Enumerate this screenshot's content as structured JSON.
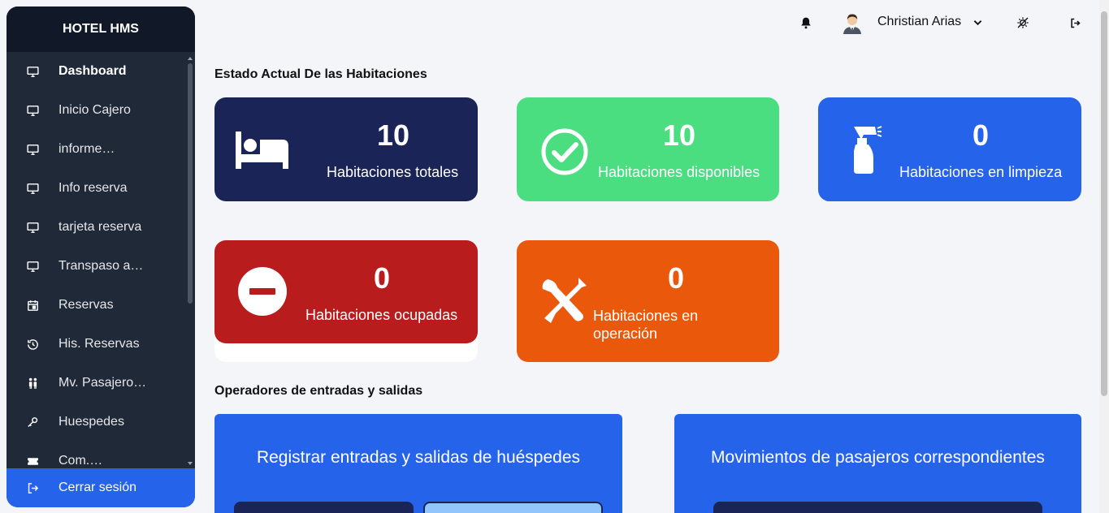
{
  "app": {
    "title": "HOTEL HMS"
  },
  "sidebar": {
    "items": [
      {
        "label": "Dashboard",
        "icon": "monitor-icon"
      },
      {
        "label": "Inicio Cajero",
        "icon": "monitor-icon"
      },
      {
        "label": "informe…",
        "icon": "monitor-icon"
      },
      {
        "label": "Info reserva",
        "icon": "monitor-icon"
      },
      {
        "label": "tarjeta reserva",
        "icon": "monitor-icon"
      },
      {
        "label": "Transpaso a…",
        "icon": "monitor-icon"
      },
      {
        "label": "Reservas",
        "icon": "calendar-icon"
      },
      {
        "label": "His. Reservas",
        "icon": "history-icon"
      },
      {
        "label": "Mv. Pasajero…",
        "icon": "people-icon"
      },
      {
        "label": "Huespedes",
        "icon": "key-icon"
      },
      {
        "label": "Com.…",
        "icon": "ticket-icon"
      }
    ],
    "logout_label": "Cerrar sesión"
  },
  "header": {
    "user_name": "Christian Arias"
  },
  "rooms": {
    "title": "Estado Actual De las Habitaciones",
    "cards": [
      {
        "value": "10",
        "label": "Habitaciones totales",
        "color": "#1b2457",
        "icon": "bed-icon"
      },
      {
        "value": "10",
        "label": "Habitaciones disponibles",
        "color": "#4ade80",
        "icon": "check-circle-icon"
      },
      {
        "value": "0",
        "label": "Habitaciones en limpieza",
        "color": "#2563eb",
        "icon": "spray-bottle-icon"
      },
      {
        "value": "0",
        "label": "Habitaciones ocupadas",
        "color": "#b91c1c",
        "icon": "minus-circle-icon"
      },
      {
        "value": "0",
        "label": "Habitaciones en operación",
        "color": "#ea580c",
        "icon": "tools-icon"
      }
    ]
  },
  "operators": {
    "title": "Operadores de entradas y salidas",
    "panels": [
      {
        "title": "Registrar entradas y salidas de huéspedes"
      },
      {
        "title": "Movimientos de pasajeros correspondientes"
      }
    ]
  }
}
